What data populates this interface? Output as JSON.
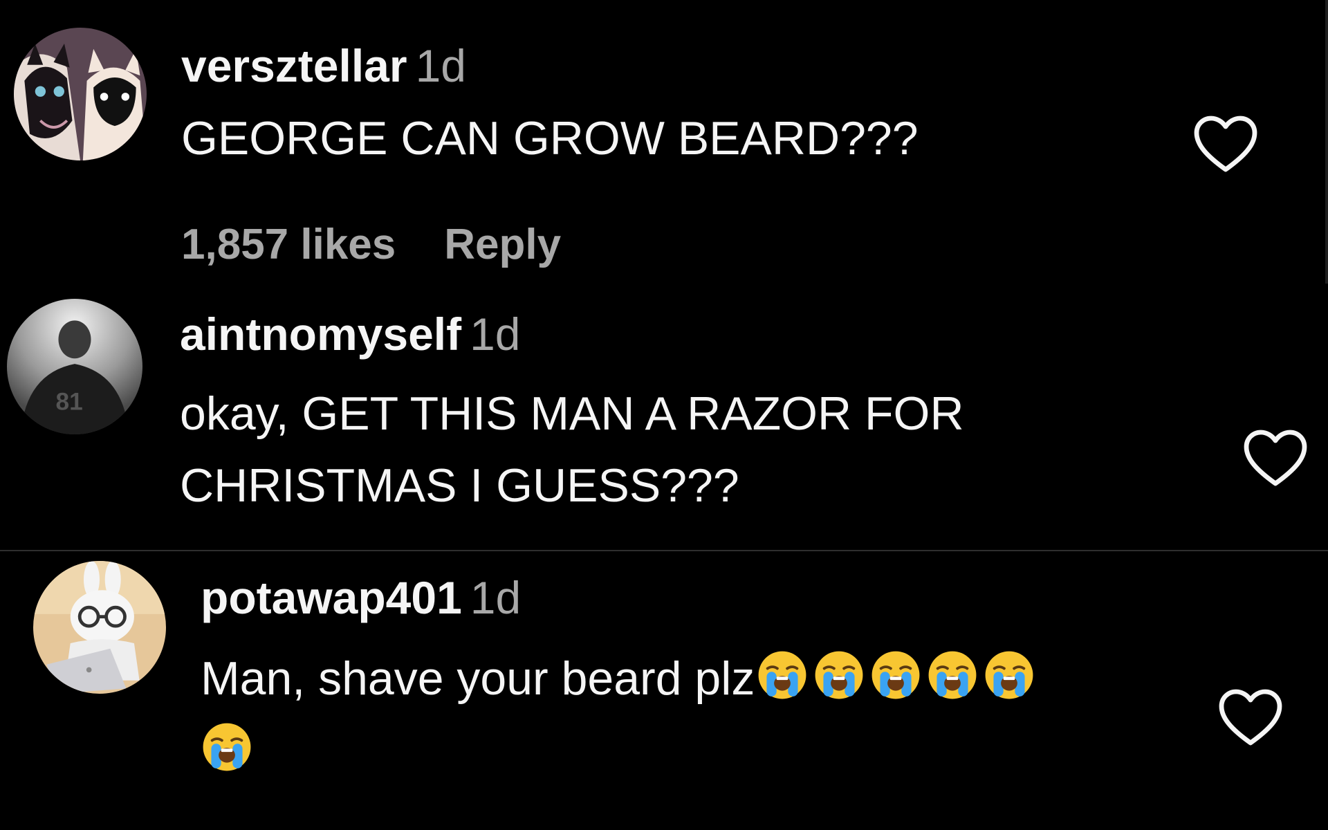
{
  "comments": [
    {
      "username": "versztellar",
      "time": "1d",
      "text_lines": [
        "GEORGE CAN GROW BEARD???"
      ],
      "likes": "1,857 likes",
      "reply": "Reply",
      "avatar_icon": "cats-avatar-icon"
    },
    {
      "username": "aintnomyself",
      "time": "1d",
      "text_lines": [
        "okay, GET THIS MAN A RAZOR FOR",
        "CHRISTMAS I GUESS???"
      ],
      "avatar_icon": "jersey-81-avatar-icon",
      "avatar_jersey_number": "81"
    },
    {
      "username": "potawap401",
      "time": "1d",
      "text_lines": [
        "Man, shave your beard plz"
      ],
      "emoji": "loudly-crying-face",
      "emoji_count_line1": 5,
      "emoji_count_line2": 1,
      "avatar_icon": "bunny-laptop-avatar-icon"
    }
  ],
  "colors": {
    "background": "#000000",
    "primary_text": "#f5f5f5",
    "secondary_text": "#a8a8a8",
    "divider": "#2e2e2e"
  },
  "icons": {
    "like": "heart-outline-icon"
  }
}
